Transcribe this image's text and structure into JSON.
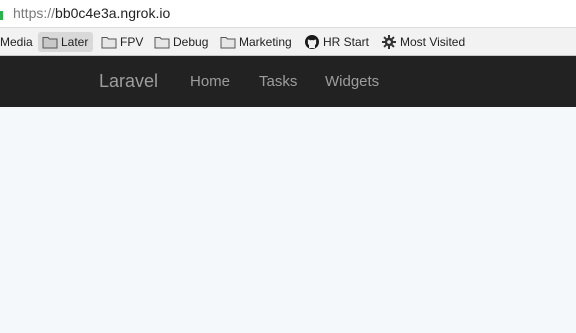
{
  "browser": {
    "url_scheme": "https://",
    "url_host": "bb0c4e3a.ngrok.io"
  },
  "bookmarks": [
    {
      "label": "Media",
      "icon": "none",
      "selected": false
    },
    {
      "label": "Later",
      "icon": "folder-icon",
      "selected": true
    },
    {
      "label": "FPV",
      "icon": "folder-icon",
      "selected": false
    },
    {
      "label": "Debug",
      "icon": "folder-icon",
      "selected": false
    },
    {
      "label": "Marketing",
      "icon": "folder-icon",
      "selected": false
    },
    {
      "label": "HR Start",
      "icon": "github-icon",
      "selected": false
    },
    {
      "label": "Most Visited",
      "icon": "gear-icon",
      "selected": false
    }
  ],
  "navbar": {
    "brand": "Laravel",
    "links": [
      "Home",
      "Tasks",
      "Widgets"
    ]
  },
  "colors": {
    "navbar_bg": "#222222",
    "nav_text": "#9d9d9d",
    "page_bg": "#f5f8fa",
    "secure_indicator": "#2bb24c"
  }
}
